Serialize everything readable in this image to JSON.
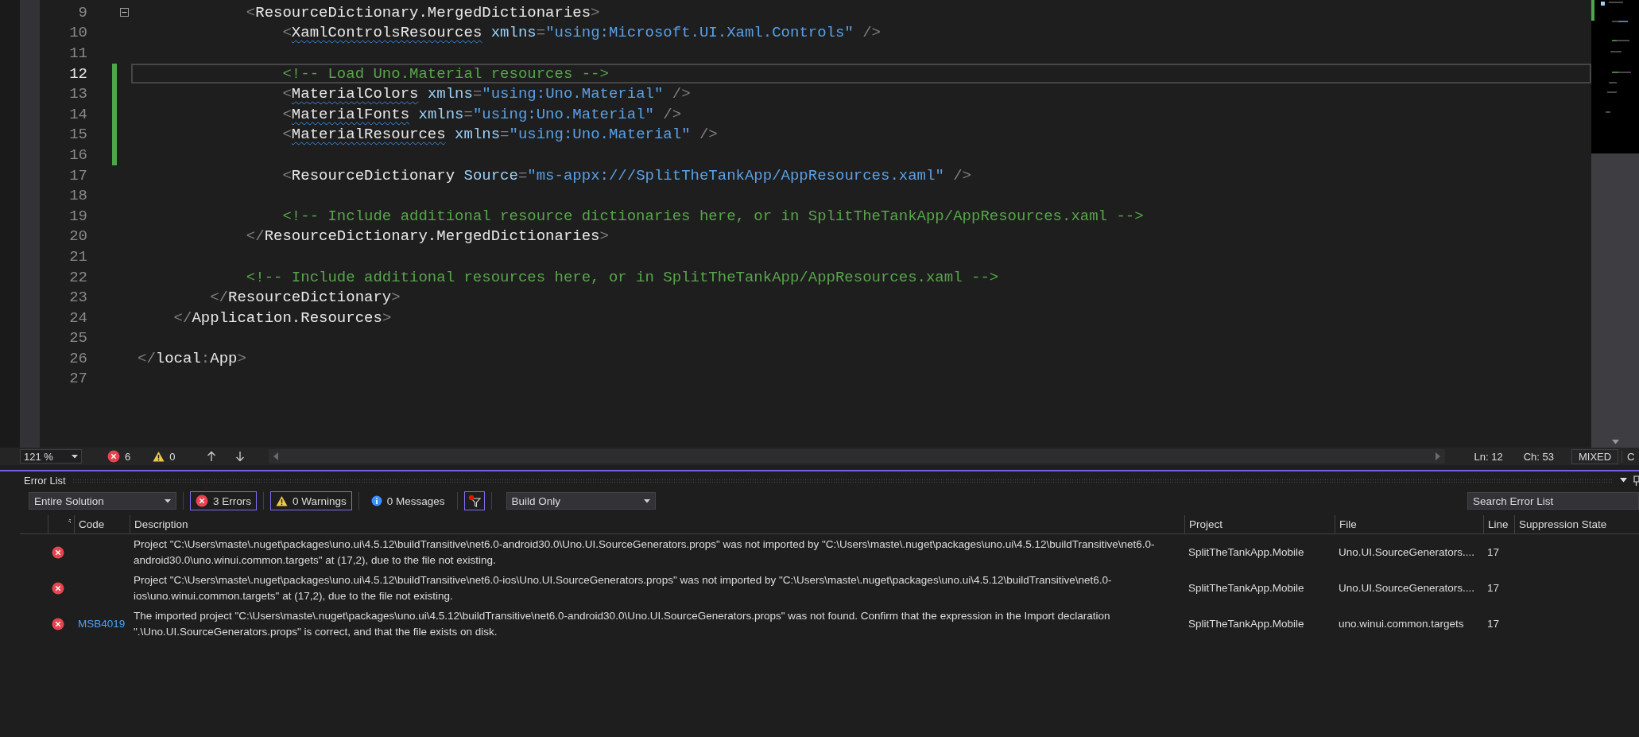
{
  "editor": {
    "lines": [
      {
        "number": "9",
        "changed": false,
        "current": false,
        "foldable": true,
        "tokens": [
          {
            "kind": "punct",
            "text": "            <"
          },
          {
            "kind": "tag",
            "text": "ResourceDictionary.MergedDictionaries",
            "squiggle": false
          },
          {
            "kind": "punct",
            "text": ">"
          }
        ]
      },
      {
        "number": "10",
        "changed": false,
        "current": false,
        "foldable": false,
        "tokens": [
          {
            "kind": "punct",
            "text": "                <"
          },
          {
            "kind": "tag",
            "text": "XamlControlsResources",
            "squiggle": true
          },
          {
            "kind": "attr",
            "text": " xmlns"
          },
          {
            "kind": "punct",
            "text": "="
          },
          {
            "kind": "value",
            "text": "\"using:Microsoft.UI.Xaml.Controls\""
          },
          {
            "kind": "punct",
            "text": " />"
          }
        ]
      },
      {
        "number": "11",
        "changed": false,
        "current": false,
        "foldable": false
      },
      {
        "number": "12",
        "changed": true,
        "current": true,
        "foldable": false,
        "tokens": [
          {
            "kind": "comment",
            "text": "                <!-- Load Uno.Material resources -->"
          }
        ]
      },
      {
        "number": "13",
        "changed": true,
        "current": false,
        "foldable": false,
        "tokens": [
          {
            "kind": "punct",
            "text": "                <"
          },
          {
            "kind": "tag",
            "text": "MaterialColors",
            "squiggle": true
          },
          {
            "kind": "attr",
            "text": " xmlns"
          },
          {
            "kind": "punct",
            "text": "="
          },
          {
            "kind": "value",
            "text": "\"using:Uno.Material\""
          },
          {
            "kind": "punct",
            "text": " />"
          }
        ]
      },
      {
        "number": "14",
        "changed": true,
        "current": false,
        "foldable": false,
        "tokens": [
          {
            "kind": "punct",
            "text": "                <"
          },
          {
            "kind": "tag",
            "text": "MaterialFonts",
            "squiggle": true
          },
          {
            "kind": "attr",
            "text": " xmlns"
          },
          {
            "kind": "punct",
            "text": "="
          },
          {
            "kind": "value",
            "text": "\"using:Uno.Material\""
          },
          {
            "kind": "punct",
            "text": " />"
          }
        ]
      },
      {
        "number": "15",
        "changed": true,
        "current": false,
        "foldable": false,
        "tokens": [
          {
            "kind": "punct",
            "text": "                <"
          },
          {
            "kind": "tag",
            "text": "MaterialResources",
            "squiggle": true
          },
          {
            "kind": "attr",
            "text": " xmlns"
          },
          {
            "kind": "punct",
            "text": "="
          },
          {
            "kind": "value",
            "text": "\"using:Uno.Material\""
          },
          {
            "kind": "punct",
            "text": " />"
          }
        ]
      },
      {
        "number": "16",
        "changed": true,
        "current": false,
        "foldable": false
      },
      {
        "number": "17",
        "changed": false,
        "current": false,
        "foldable": false,
        "tokens": [
          {
            "kind": "punct",
            "text": "                <"
          },
          {
            "kind": "tag",
            "text": "ResourceDictionary",
            "squiggle": false
          },
          {
            "kind": "attr",
            "text": " Source"
          },
          {
            "kind": "punct",
            "text": "="
          },
          {
            "kind": "value",
            "text": "\"ms-appx:///SplitTheTankApp/AppResources.xaml\""
          },
          {
            "kind": "punct",
            "text": " />"
          }
        ]
      },
      {
        "number": "18",
        "changed": false,
        "current": false,
        "foldable": false
      },
      {
        "number": "19",
        "changed": false,
        "current": false,
        "foldable": false,
        "tokens": [
          {
            "kind": "comment",
            "text": "                <!-- Include additional resource dictionaries here, or in SplitTheTankApp/AppResources.xaml -->"
          }
        ]
      },
      {
        "number": "20",
        "changed": false,
        "current": false,
        "foldable": false,
        "tokens": [
          {
            "kind": "punct",
            "text": "            </"
          },
          {
            "kind": "tag",
            "text": "ResourceDictionary.MergedDictionaries",
            "squiggle": false
          },
          {
            "kind": "punct",
            "text": ">"
          }
        ]
      },
      {
        "number": "21",
        "changed": false,
        "current": false,
        "foldable": false
      },
      {
        "number": "22",
        "changed": false,
        "current": false,
        "foldable": false,
        "tokens": [
          {
            "kind": "comment",
            "text": "            <!-- Include additional resources here, or in SplitTheTankApp/AppResources.xaml -->"
          }
        ]
      },
      {
        "number": "23",
        "changed": false,
        "current": false,
        "foldable": false,
        "tokens": [
          {
            "kind": "punct",
            "text": "        </"
          },
          {
            "kind": "tag",
            "text": "ResourceDictionary",
            "squiggle": false
          },
          {
            "kind": "punct",
            "text": ">"
          }
        ]
      },
      {
        "number": "24",
        "changed": false,
        "current": false,
        "foldable": false,
        "tokens": [
          {
            "kind": "punct",
            "text": "    </"
          },
          {
            "kind": "tag",
            "text": "Application.Resources",
            "squiggle": false
          },
          {
            "kind": "punct",
            "text": ">"
          }
        ]
      },
      {
        "number": "25",
        "changed": false,
        "current": false,
        "foldable": false
      },
      {
        "number": "26",
        "changed": false,
        "current": false,
        "foldable": false,
        "tokens": [
          {
            "kind": "punct",
            "text": "</"
          },
          {
            "kind": "tag",
            "text": "local",
            "squiggle": false
          },
          {
            "kind": "punct",
            "text": ":"
          },
          {
            "kind": "tag",
            "text": "App",
            "squiggle": false
          },
          {
            "kind": "punct",
            "text": ">"
          }
        ]
      },
      {
        "number": "27",
        "changed": false,
        "current": false,
        "foldable": false
      }
    ]
  },
  "status_bar": {
    "zoom": "121 %",
    "error_count": "6",
    "warning_count": "0",
    "line": "Ln: 12",
    "column": "Ch: 53",
    "line_endings": "MIXED",
    "encoding": "C"
  },
  "error_list": {
    "title": "Error List",
    "toolbar": {
      "scope": "Entire Solution",
      "filters": [
        {
          "kind": "error",
          "label": "3 Errors",
          "selected": true
        },
        {
          "kind": "warning",
          "label": "0 Warnings",
          "selected": true
        },
        {
          "kind": "info",
          "label": "0 Messages",
          "selected": false
        }
      ],
      "filter_button_selected": true,
      "build_scope": "Build Only",
      "search": {
        "placeholder": "Search Error List"
      }
    },
    "columns": [
      "Code",
      "Description",
      "Project",
      "File",
      "Line",
      "Suppression State"
    ],
    "rows": [
      {
        "kind": "error",
        "description": "Project \"C:\\Users\\maste\\.nuget\\packages\\uno.ui\\4.5.12\\buildTransitive\\net6.0-android30.0\\Uno.UI.SourceGenerators.props\" was not imported by \"C:\\Users\\maste\\.nuget\\packages\\uno.ui\\4.5.12\\buildTransitive\\net6.0-android30.0\\uno.winui.common.targets\" at (17,2), due to the file not existing.",
        "project": "SplitTheTankApp.Mobile",
        "file": "Uno.UI.SourceGenerators....",
        "line": "17"
      },
      {
        "kind": "error",
        "description": "Project \"C:\\Users\\maste\\.nuget\\packages\\uno.ui\\4.5.12\\buildTransitive\\net6.0-ios\\Uno.UI.SourceGenerators.props\" was not imported by \"C:\\Users\\maste\\.nuget\\packages\\uno.ui\\4.5.12\\buildTransitive\\net6.0-ios\\uno.winui.common.targets\" at (17,2), due to the file not existing.",
        "project": "SplitTheTankApp.Mobile",
        "file": "Uno.UI.SourceGenerators....",
        "line": "17"
      },
      {
        "kind": "error",
        "code": "MSB4019",
        "description": "The imported project \"C:\\Users\\maste\\.nuget\\packages\\uno.ui\\4.5.12\\buildTransitive\\net6.0-android30.0\\Uno.UI.SourceGenerators.props\" was not found. Confirm that the expression in the Import declaration \".\\Uno.UI.SourceGenerators.props\" is correct, and that the file exists on disk.",
        "project": "SplitTheTankApp.Mobile",
        "file": "uno.winui.common.targets",
        "line": "17"
      }
    ]
  }
}
